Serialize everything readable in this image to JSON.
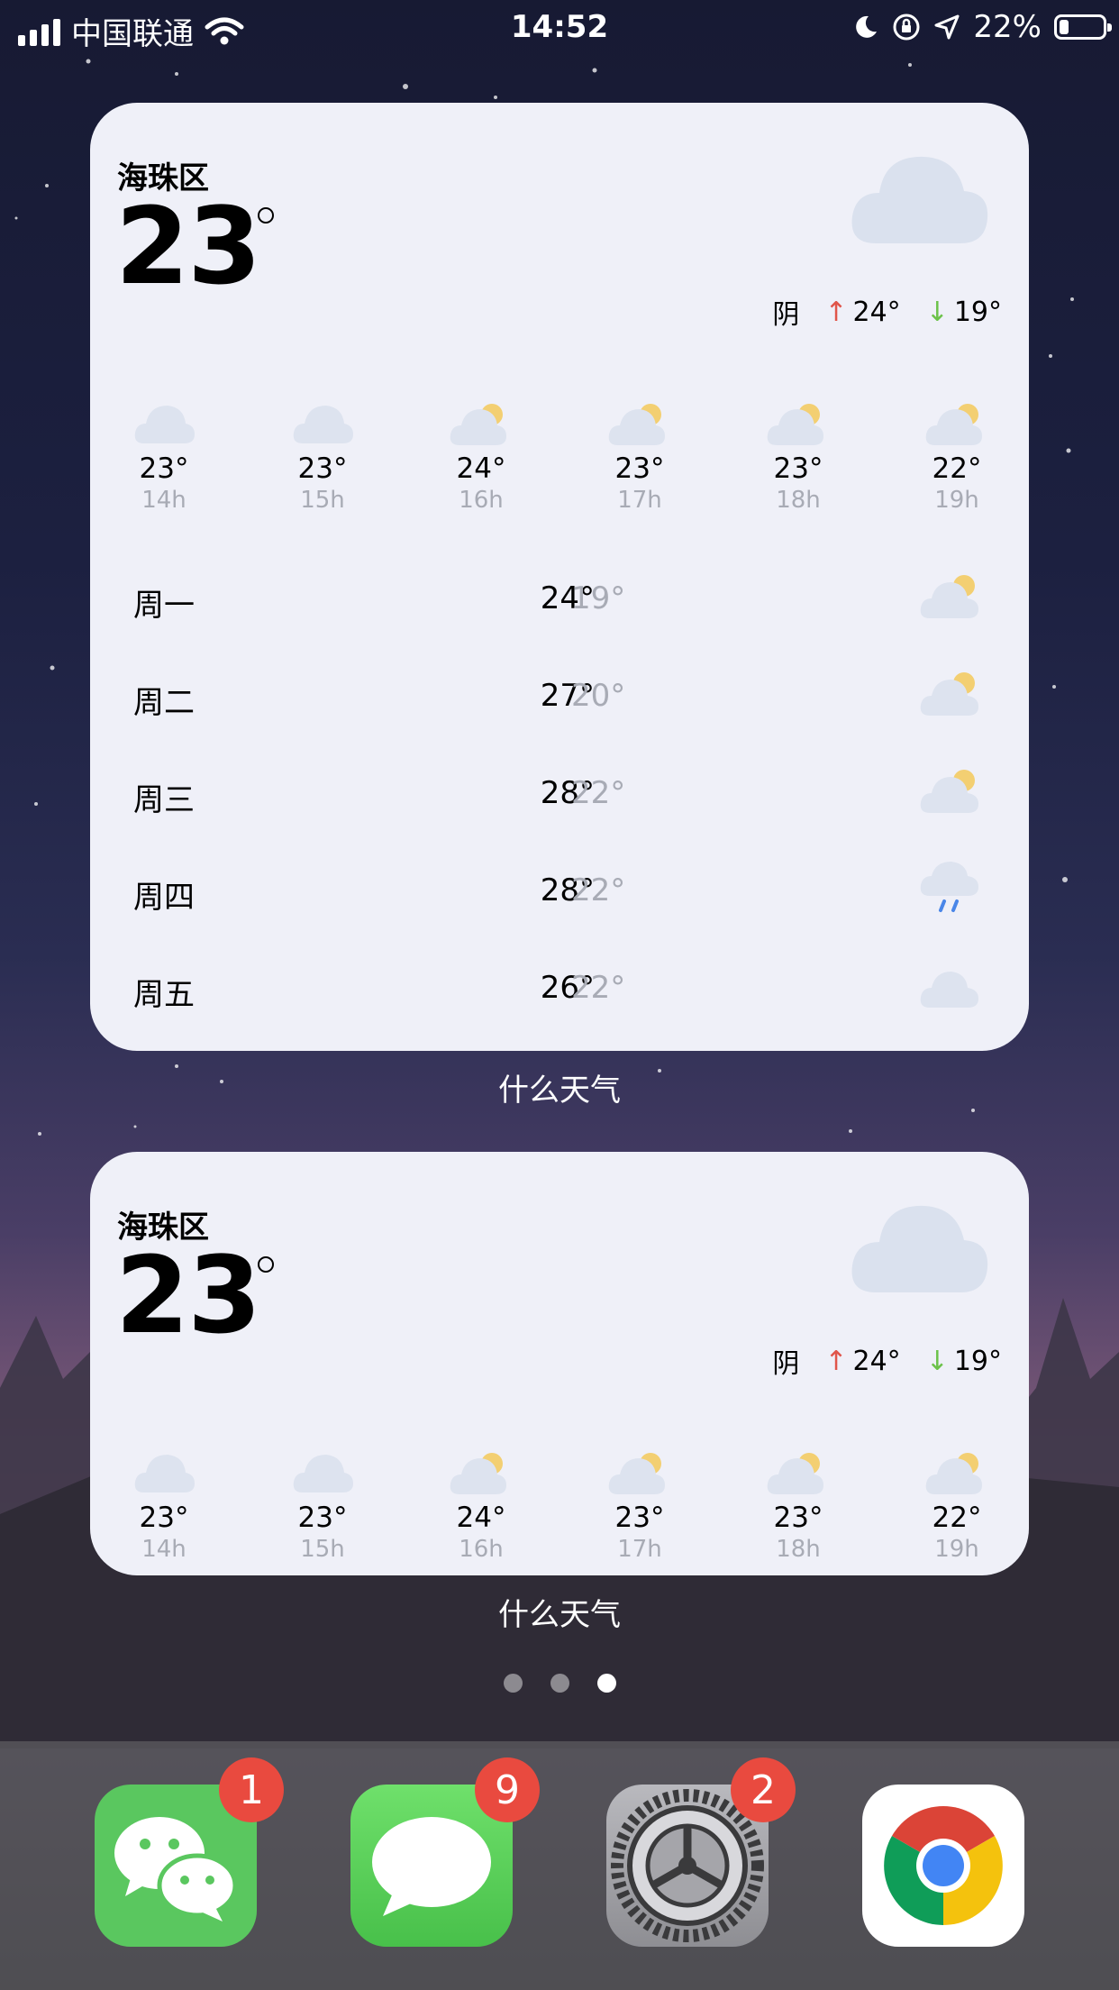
{
  "status_bar": {
    "carrier": "中国联通",
    "time": "14:52",
    "battery_percent": "22%",
    "battery_level": 0.22,
    "icons": [
      "signal-icon",
      "wifi-icon",
      "moon-icon",
      "rotation-lock-icon",
      "location-icon",
      "battery-icon"
    ]
  },
  "widget_large": {
    "location": "海珠区",
    "temperature": "23",
    "condition": "阴",
    "high": "24°",
    "low": "19°",
    "hourly": [
      {
        "temp": "23°",
        "hour": "14h",
        "icon": "cloud-icon"
      },
      {
        "temp": "23°",
        "hour": "15h",
        "icon": "cloud-icon"
      },
      {
        "temp": "24°",
        "hour": "16h",
        "icon": "partly-cloudy-icon"
      },
      {
        "temp": "23°",
        "hour": "17h",
        "icon": "partly-cloudy-icon"
      },
      {
        "temp": "23°",
        "hour": "18h",
        "icon": "partly-cloudy-icon"
      },
      {
        "temp": "22°",
        "hour": "19h",
        "icon": "partly-cloudy-icon"
      }
    ],
    "daily": [
      {
        "day": "周一",
        "high": "24°",
        "low": "19°",
        "icon": "partly-cloudy-icon"
      },
      {
        "day": "周二",
        "high": "27°",
        "low": "20°",
        "icon": "partly-cloudy-icon"
      },
      {
        "day": "周三",
        "high": "28°",
        "low": "22°",
        "icon": "partly-cloudy-icon"
      },
      {
        "day": "周四",
        "high": "28°",
        "low": "22°",
        "icon": "rain-icon"
      },
      {
        "day": "周五",
        "high": "26°",
        "low": "22°",
        "icon": "cloud-icon"
      }
    ],
    "app_label": "什么天气"
  },
  "widget_medium": {
    "location": "海珠区",
    "temperature": "23",
    "condition": "阴",
    "high": "24°",
    "low": "19°",
    "hourly": [
      {
        "temp": "23°",
        "hour": "14h",
        "icon": "cloud-icon"
      },
      {
        "temp": "23°",
        "hour": "15h",
        "icon": "cloud-icon"
      },
      {
        "temp": "24°",
        "hour": "16h",
        "icon": "partly-cloudy-icon"
      },
      {
        "temp": "23°",
        "hour": "17h",
        "icon": "partly-cloudy-icon"
      },
      {
        "temp": "23°",
        "hour": "18h",
        "icon": "partly-cloudy-icon"
      },
      {
        "temp": "22°",
        "hour": "19h",
        "icon": "partly-cloudy-icon"
      }
    ],
    "app_label": "什么天气"
  },
  "page_indicator": {
    "count": 3,
    "active": 3
  },
  "dock": [
    {
      "app": "WeChat",
      "icon": "wechat-icon",
      "badge": "1",
      "color": "#5ac75f"
    },
    {
      "app": "Messages",
      "icon": "messages-icon",
      "badge": "9",
      "color": "#5ed35b"
    },
    {
      "app": "Settings",
      "icon": "settings-gear-icon",
      "badge": "2",
      "color": "#8e8e93"
    },
    {
      "app": "Chrome",
      "icon": "chrome-icon",
      "badge": "",
      "color": "#ffffff"
    }
  ],
  "colors": {
    "widget_bg": "#eff0f8",
    "high_arrow": "#e0554a",
    "low_arrow": "#6cc24a",
    "badge": "#e94a3f",
    "muted_text": "#a8abb5"
  }
}
